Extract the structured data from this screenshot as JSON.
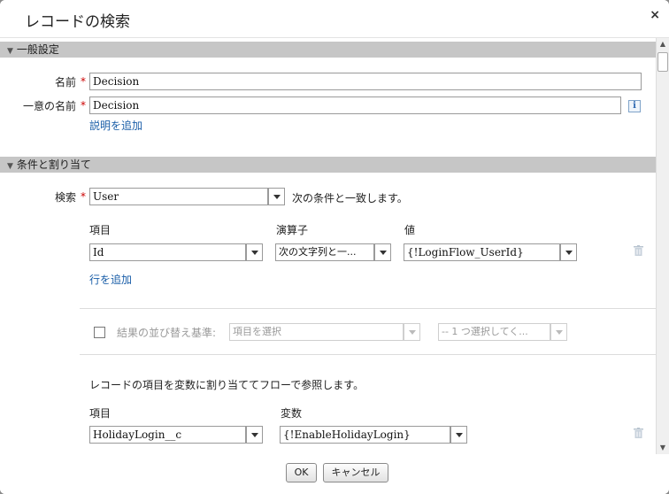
{
  "dialog": {
    "title": "レコードの検索",
    "close_label": "×"
  },
  "general": {
    "header": "一般設定",
    "name_label": "名前",
    "name_value": "Decision",
    "unique_name_label": "一意の名前",
    "unique_name_value": "Decision",
    "info_label": "i",
    "add_description": "説明を追加",
    "required_mark": "*"
  },
  "conditions": {
    "header": "条件と割り当て",
    "lookup_label": "検索",
    "lookup_value": "User",
    "match_text": "次の条件と一致します。",
    "columns": {
      "field": "項目",
      "operator": "演算子",
      "value": "値"
    },
    "row": {
      "field": "Id",
      "operator": "次の文字列と一...",
      "value": "{!LoginFlow_UserId}"
    },
    "add_row": "行を追加",
    "sort_label": "結果の並び替え基準:",
    "sort_field_placeholder": "項目を選択",
    "sort_order_placeholder": "-- 1 つ選択してく...",
    "assign_text": "レコードの項目を変数に割り当ててフローで参照します。",
    "assign_columns": {
      "field": "項目",
      "variable": "変数"
    },
    "assign_row": {
      "field": "HolidayLogin__c",
      "variable": "{!EnableHolidayLogin}"
    }
  },
  "footer": {
    "ok_label": "OK",
    "cancel_label": "キャンセル"
  }
}
